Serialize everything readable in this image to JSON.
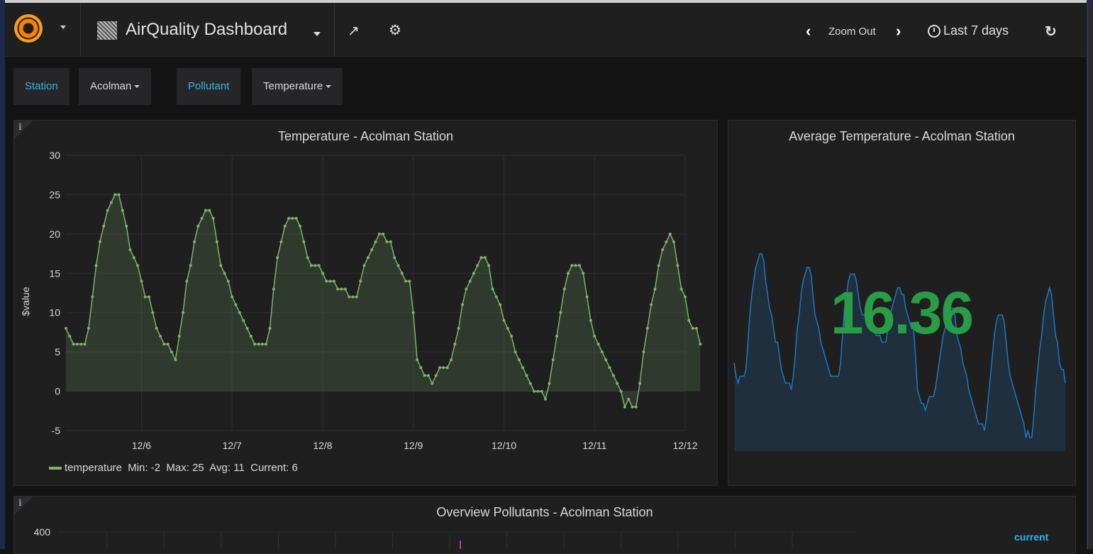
{
  "navbar": {
    "logo_icon": "grafana-logo-icon",
    "dashboard_title": "AirQuality Dashboard",
    "share_icon": "share-icon",
    "settings_icon": "gear-icon",
    "zoom_out_label": "Zoom Out",
    "time_range": "Last 7 days",
    "refresh_icon": "refresh-icon"
  },
  "template_vars": [
    {
      "label": "Station",
      "value": "Acolman"
    },
    {
      "label": "Pollutant",
      "value": "Temperature"
    }
  ],
  "panels": {
    "temperature": {
      "title": "Temperature - Acolman Station",
      "legend": {
        "series": "temperature",
        "min": "Min: -2",
        "max": "Max: 25",
        "avg": "Avg: 11",
        "current": "Current: 6"
      }
    },
    "average": {
      "title": "Average Temperature - Acolman Station",
      "value": "16.36"
    },
    "overview": {
      "title": "Overview Pollutants - Acolman Station",
      "y_top_tick": "400",
      "legend_header": "current"
    }
  },
  "colors": {
    "series": "#7eb26d",
    "stat_value": "#299c46",
    "sparkline": "#1f78c1",
    "var_label": "#33b5e5"
  },
  "chart_data": [
    {
      "type": "line",
      "title": "Temperature - Acolman Station",
      "ylabel": "$value",
      "xlabel": "",
      "ylim": [
        -5,
        30
      ],
      "y_ticks": [
        "30",
        "25",
        "20",
        "15",
        "10",
        "5",
        "0",
        "-5"
      ],
      "x_ticks": [
        "12/6",
        "12/7",
        "12/8",
        "12/9",
        "12/10",
        "12/11",
        "12/12"
      ],
      "x_tick_hours": [
        20,
        44,
        68,
        92,
        116,
        140,
        164
      ],
      "x_range_hours": [
        0,
        164
      ],
      "grid": true,
      "legend_position": "bottom",
      "series": [
        {
          "name": "temperature",
          "hourly_start": "12/5 04:00",
          "values": [
            8,
            7,
            6,
            6,
            6,
            6,
            8,
            12,
            16,
            19,
            21,
            23,
            24,
            25,
            25,
            23,
            21,
            18,
            17,
            16,
            14,
            12,
            12,
            10,
            8,
            7,
            6,
            6,
            5,
            4,
            7,
            10,
            14,
            16,
            19,
            21,
            22,
            23,
            23,
            22,
            19,
            16,
            15,
            14,
            12,
            11,
            10,
            9,
            8,
            7,
            6,
            6,
            6,
            6,
            8,
            13,
            17,
            19,
            21,
            22,
            22,
            22,
            21,
            19,
            17,
            16,
            16,
            16,
            15,
            14,
            14,
            14,
            13,
            13,
            13,
            12,
            12,
            12,
            14,
            16,
            17,
            18,
            19,
            20,
            20,
            19,
            19,
            17,
            16,
            15,
            14,
            14,
            10,
            4,
            3,
            2,
            2,
            1,
            2,
            3,
            3,
            3,
            4,
            6,
            8,
            11,
            13,
            14,
            15,
            16,
            17,
            17,
            16,
            13,
            12,
            11,
            9,
            8,
            7,
            5,
            4,
            3,
            2,
            1,
            0,
            0,
            0,
            -1,
            1,
            4,
            7,
            10,
            13,
            15,
            16,
            16,
            16,
            15,
            12,
            9,
            7,
            6,
            5,
            4,
            3,
            2,
            1,
            0,
            -2,
            -1,
            -2,
            -2,
            1,
            5,
            8,
            11,
            13,
            16,
            18,
            19,
            20,
            19,
            16,
            13,
            12,
            9,
            8,
            8,
            6
          ]
        }
      ]
    },
    {
      "type": "area",
      "title": "Average Temperature - Acolman Station",
      "stat_value": "16.36",
      "series": [
        {
          "name": "average temperature sparkline",
          "values": [
            8,
            6,
            5,
            6,
            6,
            6,
            7,
            11,
            15,
            18,
            20,
            22,
            23,
            24,
            24,
            23,
            20,
            18,
            16,
            15,
            13,
            11,
            11,
            9,
            7,
            6,
            5,
            5,
            5,
            4,
            6,
            9,
            13,
            15,
            18,
            20,
            21,
            22,
            22,
            21,
            18,
            15,
            14,
            13,
            11,
            10,
            9,
            8,
            7,
            6,
            6,
            6,
            6,
            6,
            8,
            12,
            16,
            18,
            20,
            21,
            21,
            21,
            20,
            18,
            16,
            15,
            15,
            15,
            14,
            13,
            13,
            13,
            12,
            12,
            12,
            11,
            11,
            11,
            13,
            15,
            16,
            17,
            18,
            19,
            19,
            18,
            18,
            16,
            15,
            14,
            13,
            13,
            9,
            4,
            3,
            2,
            2,
            1,
            2,
            3,
            3,
            3,
            4,
            6,
            8,
            10,
            12,
            13,
            14,
            15,
            16,
            16,
            15,
            12,
            11,
            10,
            8,
            7,
            6,
            4,
            3,
            2,
            1,
            0,
            -1,
            -1,
            -1,
            -2,
            0,
            3,
            6,
            9,
            12,
            14,
            15,
            15,
            15,
            14,
            11,
            8,
            6,
            5,
            4,
            3,
            2,
            1,
            0,
            -1,
            -3,
            -2,
            -3,
            -3,
            0,
            4,
            7,
            10,
            12,
            15,
            17,
            18,
            19,
            18,
            15,
            12,
            11,
            8,
            7,
            7,
            5
          ]
        }
      ]
    }
  ]
}
